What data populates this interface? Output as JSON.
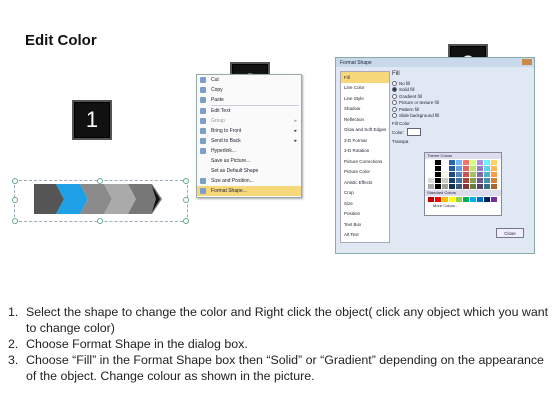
{
  "title": "Edit Color",
  "badges": [
    "1",
    "2",
    "3"
  ],
  "context_menu": {
    "items": [
      {
        "label": "Cut",
        "disabled": false
      },
      {
        "label": "Copy",
        "disabled": false
      },
      {
        "label": "Paste",
        "disabled": false
      },
      {
        "label": "Edit Text",
        "disabled": false
      },
      {
        "label": "Group",
        "disabled": true
      },
      {
        "label": "Bring to Front",
        "disabled": false
      },
      {
        "label": "Send to Back",
        "disabled": false
      },
      {
        "label": "Hyperlink...",
        "disabled": false
      },
      {
        "label": "Save as Picture...",
        "disabled": false
      },
      {
        "label": "Set as Default Shape",
        "disabled": false
      },
      {
        "label": "Size and Position...",
        "disabled": false
      },
      {
        "label": "Format Shape...",
        "disabled": false,
        "highlighted": true
      }
    ]
  },
  "dialog": {
    "title": "Format Shape",
    "sidebar": [
      "Fill",
      "Line Color",
      "Line Style",
      "Shadow",
      "Reflection",
      "Glow and Soft Edges",
      "3-D Format",
      "3-D Rotation",
      "Picture Corrections",
      "Picture Color",
      "Artistic Effects",
      "Crop",
      "Size",
      "Position",
      "Text Box",
      "Alt Text"
    ],
    "section": "Fill",
    "options": [
      "No fill",
      "Solid fill",
      "Gradient fill",
      "Picture or texture fill",
      "Pattern fill",
      "Slide background fill"
    ],
    "selected_option": "Solid fill",
    "fill_color_label": "Fill Color",
    "color_label": "Color:",
    "transparency_label": "Transpa",
    "palette": {
      "theme_label": "Theme Colors",
      "standard_label": "Standard Colors",
      "more_label": "More Colors..."
    },
    "close_label": "Close"
  },
  "steps": [
    {
      "num": "1.",
      "text": "Select the shape to change the color and Right click the object( click any object which you want to change color)"
    },
    {
      "num": "2.",
      "text": "Choose Format Shape in the dialog box."
    },
    {
      "num": "3.",
      "text": "Choose “Fill” in the Format Shape box then “Solid” or “Gradient” depending on the appearance of the object. Change colour as shown in the picture."
    }
  ],
  "colors": {
    "accent": "#1ea0e6",
    "badge": "#111111",
    "highlight": "#f6d77a"
  }
}
